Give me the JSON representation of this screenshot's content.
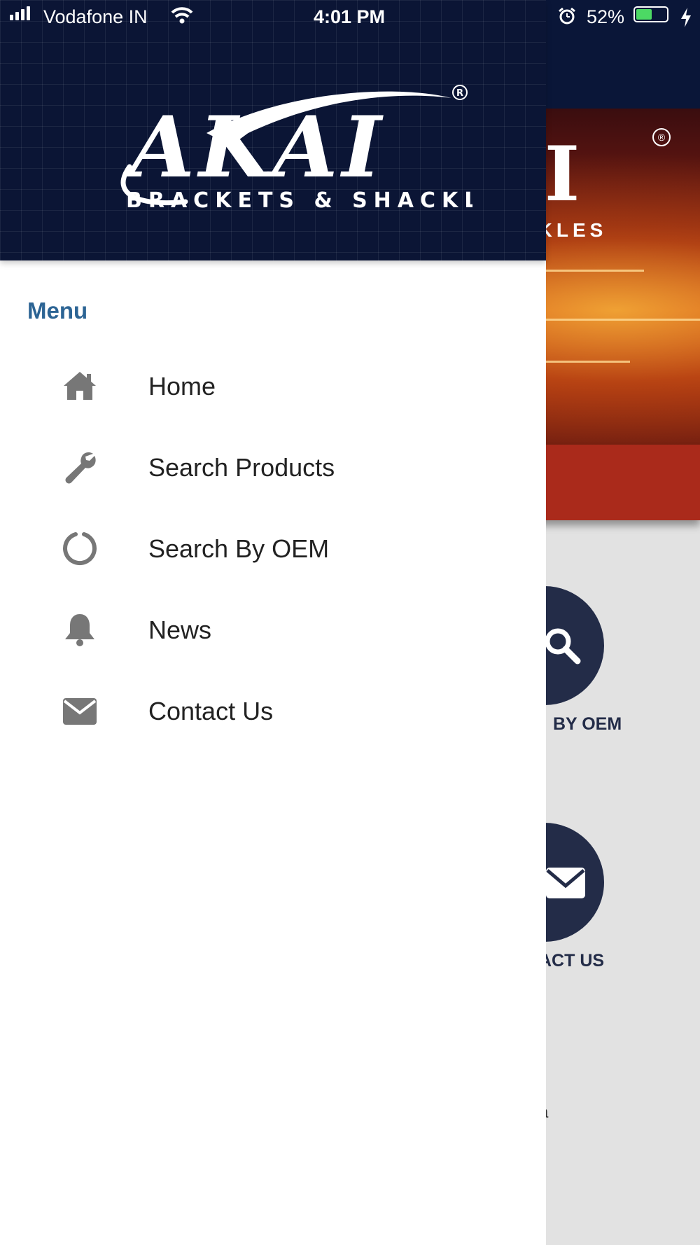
{
  "status_bar": {
    "carrier": "Vodafone IN",
    "time": "4:01 PM",
    "battery_percent": "52%",
    "battery_level": 0.52
  },
  "drawer": {
    "logo": {
      "brand": "AKAI",
      "tagline": "BRACKETS & SHACKLES",
      "registered_mark": "®"
    },
    "menu_title": "Menu",
    "items": [
      {
        "label": "Home",
        "icon": "home-icon"
      },
      {
        "label": "Search Products",
        "icon": "wrench-icon"
      },
      {
        "label": "Search By OEM",
        "icon": "circle-notch-icon"
      },
      {
        "label": "News",
        "icon": "bell-icon"
      },
      {
        "label": "Contact Us",
        "icon": "envelope-icon"
      }
    ],
    "colors": {
      "header_bg": "#0b1535",
      "menu_title": "#2c6494",
      "icon": "#777777"
    }
  },
  "background_app": {
    "banner_logo_partial": "AI",
    "banner_tagline_partial": "HACKLES",
    "tile_1_label_partial": "BY OEM",
    "tile_2_label_partial": "ACT US",
    "bottom_text_1_partial": "Y",
    "bottom_text_2_partial": "a",
    "colors": {
      "header": "#0a1638",
      "red_bar": "#aa2a1b",
      "tile_circle": "#232c48",
      "page_bg": "#e2e2e2"
    }
  }
}
